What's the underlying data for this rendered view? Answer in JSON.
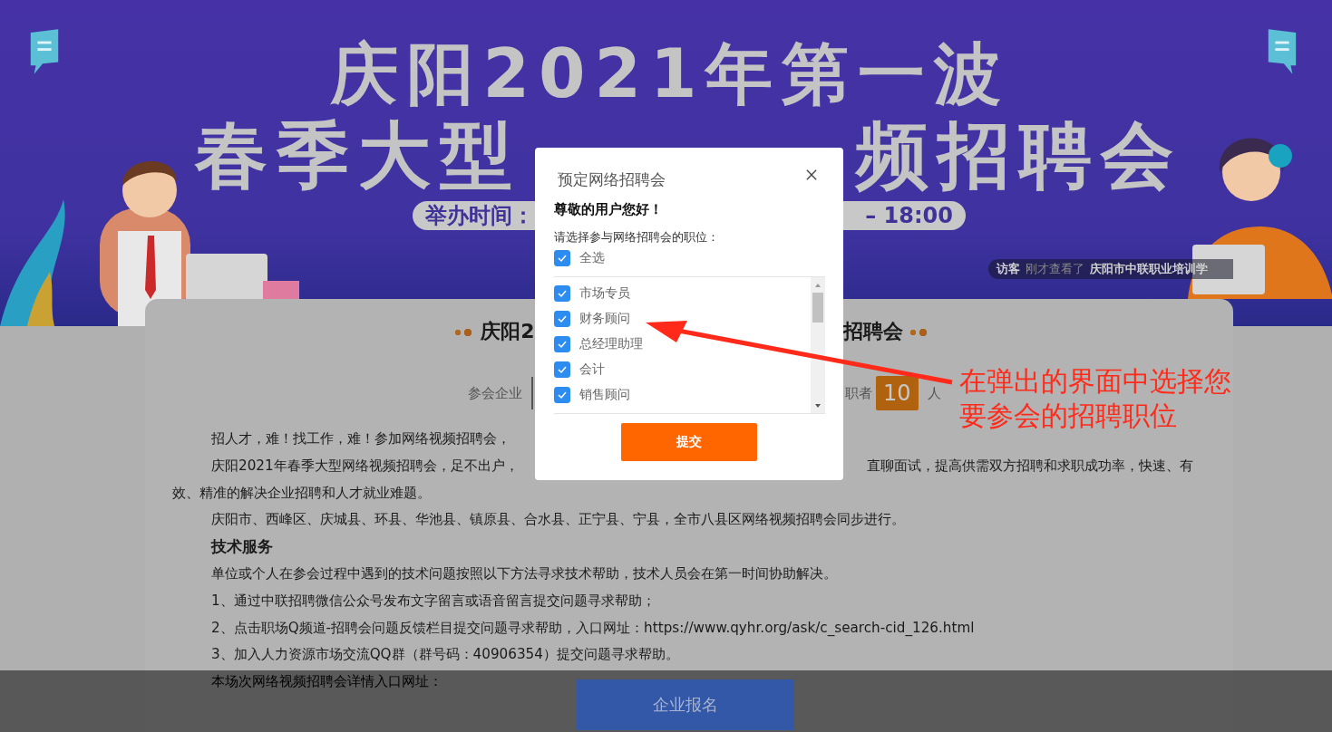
{
  "banner": {
    "title_line_1": "庆阳2021年第一波",
    "title_line_2_left": "春季大型",
    "title_line_2_right": "频招聘会",
    "time_left": "举办时间：",
    "time_right": "– 18:00",
    "ticker": {
      "label": "访客",
      "action": "刚才查看了",
      "name": "庆阳市中联职业培训学"
    }
  },
  "card": {
    "title_left": "庆阳2",
    "title_right": "招聘会",
    "stats": {
      "left_label": "参会企业",
      "right_label": "职者",
      "count": "10",
      "unit": "人"
    },
    "intro_1": "招人才，难！找工作，难！参加网络视频招聘会，",
    "intro_2": {
      "left": "庆阳2021年春季大型网络视频招聘会，足不出户，",
      "right": "直聊面试，提高供需双方招聘和求职成功率，快速、有",
      "continued": "效、精准的解决企业招聘和人才就业难题。"
    },
    "lines": [
      {
        "kind": "text",
        "text": "庆阳市、西峰区、庆城县、环县、华池县、镇原县、合水县、正宁县、宁县，全市八县区网络视频招聘会同步进行。"
      },
      {
        "kind": "heading",
        "text": "技术服务"
      },
      {
        "kind": "text",
        "text": "单位或个人在参会过程中遇到的技术问题按照以下方法寻求技术帮助，技术人员会在第一时间协助解决。"
      },
      {
        "kind": "text",
        "text": "1、通过中联招聘微信公众号发布文字留言或语音留言提交问题寻求帮助；"
      },
      {
        "kind": "text",
        "text": "2、点击职场Q频道-招聘会问题反馈栏目提交问题寻求帮助，入口网址：https://www.qyhr.org/ask/c_search-cid_126.html"
      },
      {
        "kind": "text",
        "text": "3、加入人力资源市场交流QQ群（群号码：40906354）提交问题寻求帮助。"
      },
      {
        "kind": "text",
        "text": "本场次网络视频招聘会详情入口网址："
      }
    ]
  },
  "modal": {
    "title": "预定网络招聘会",
    "greeting": "尊敬的用户您好！",
    "prompt": "请选择参与网络招聘会的职位：",
    "select_all": {
      "label": "全选",
      "checked": true
    },
    "positions": [
      {
        "label": "市场专员",
        "checked": true
      },
      {
        "label": "财务顾问",
        "checked": true
      },
      {
        "label": "总经理助理",
        "checked": true
      },
      {
        "label": "会计",
        "checked": true
      },
      {
        "label": "销售顾问",
        "checked": true
      }
    ],
    "submit": "提交"
  },
  "footer": {
    "button": "企业报名"
  },
  "annotation": {
    "text": "在弹出的界面中选择您要参会的招聘职位"
  }
}
